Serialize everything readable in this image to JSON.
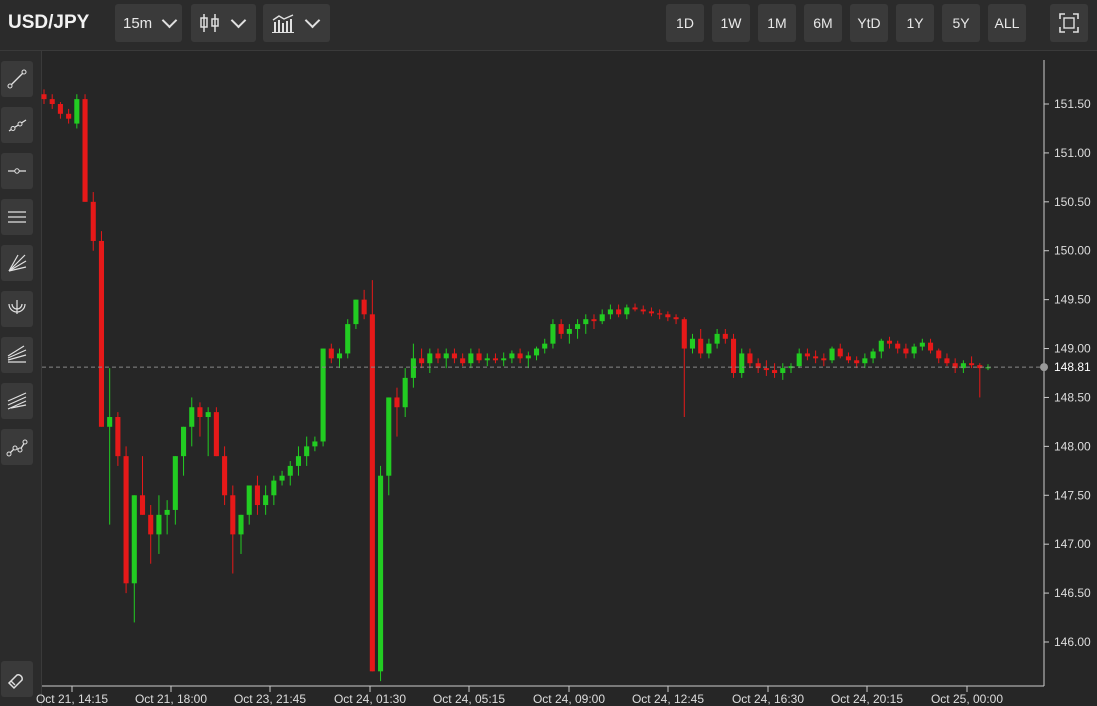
{
  "header": {
    "symbol": "USD/JPY",
    "interval": "15m",
    "chart_style_icon": "candlestick-icon",
    "indicator_icon": "bar-chart-icon",
    "ranges": [
      "1D",
      "1W",
      "1M",
      "6M",
      "YtD",
      "1Y",
      "5Y",
      "ALL"
    ],
    "fullscreen_icon": "fullscreen-icon"
  },
  "toolbar": {
    "tools": [
      "trend-line-icon",
      "ray-icon",
      "horizontal-line-icon",
      "parallel-channel-icon",
      "fan-icon",
      "arc-icon",
      "regression-channel-icon",
      "pitchfork-icon",
      "polyline-icon"
    ],
    "magnet_icon": "magnet-icon"
  },
  "chart_data": {
    "type": "candlestick",
    "symbol": "USD/JPY",
    "interval": "15m",
    "y_ticks": [
      "151.50",
      "151.00",
      "150.50",
      "150.00",
      "149.50",
      "149.00",
      "148.50",
      "148.00",
      "147.50",
      "147.00",
      "146.50",
      "146.00"
    ],
    "x_ticks": [
      "Oct 21, 14:15",
      "Oct 21, 18:00",
      "Oct 23, 21:45",
      "Oct 24, 01:30",
      "Oct 24, 05:15",
      "Oct 24, 09:00",
      "Oct 24, 12:45",
      "Oct 24, 16:30",
      "Oct 24, 20:15",
      "Oct 25, 00:00"
    ],
    "ylim": [
      145.55,
      151.95
    ],
    "last_price": "148.81",
    "last_price_value": 148.81,
    "grid": false,
    "colors": {
      "up": "#22cc22",
      "down": "#e61919",
      "background": "#262626",
      "axis": "#cccccc",
      "crosshair": "#888888"
    },
    "candles": [
      [
        151.6,
        151.65,
        151.5,
        151.55
      ],
      [
        151.55,
        151.6,
        151.45,
        151.5
      ],
      [
        151.5,
        151.52,
        151.35,
        151.4
      ],
      [
        151.4,
        151.45,
        151.3,
        151.35
      ],
      [
        151.3,
        151.6,
        151.25,
        151.55
      ],
      [
        151.55,
        151.6,
        150.5,
        150.5
      ],
      [
        150.5,
        150.6,
        150.0,
        150.1
      ],
      [
        150.1,
        150.2,
        148.2,
        148.2
      ],
      [
        148.2,
        148.8,
        147.2,
        148.3
      ],
      [
        148.3,
        148.35,
        147.8,
        147.9
      ],
      [
        147.9,
        148.0,
        146.5,
        146.6
      ],
      [
        146.6,
        147.5,
        146.2,
        147.5
      ],
      [
        147.5,
        147.9,
        147.3,
        147.3
      ],
      [
        147.3,
        147.4,
        146.8,
        147.1
      ],
      [
        147.1,
        147.5,
        146.9,
        147.3
      ],
      [
        147.3,
        147.45,
        147.1,
        147.35
      ],
      [
        147.35,
        147.9,
        147.2,
        147.9
      ],
      [
        147.9,
        148.2,
        147.7,
        148.2
      ],
      [
        148.2,
        148.5,
        148.0,
        148.4
      ],
      [
        148.4,
        148.45,
        148.1,
        148.3
      ],
      [
        148.3,
        148.4,
        147.9,
        148.35
      ],
      [
        148.35,
        148.4,
        147.9,
        147.9
      ],
      [
        147.9,
        148.0,
        147.4,
        147.5
      ],
      [
        147.5,
        147.6,
        146.7,
        147.1
      ],
      [
        147.1,
        147.3,
        146.9,
        147.3
      ],
      [
        147.3,
        147.6,
        147.2,
        147.6
      ],
      [
        147.6,
        147.7,
        147.3,
        147.4
      ],
      [
        147.4,
        147.6,
        147.3,
        147.5
      ],
      [
        147.5,
        147.7,
        147.4,
        147.65
      ],
      [
        147.65,
        147.75,
        147.6,
        147.7
      ],
      [
        147.7,
        147.85,
        147.6,
        147.8
      ],
      [
        147.8,
        148.0,
        147.7,
        147.9
      ],
      [
        147.9,
        148.1,
        147.8,
        148.0
      ],
      [
        148.0,
        148.1,
        147.95,
        148.05
      ],
      [
        148.05,
        149.0,
        148.0,
        149.0
      ],
      [
        149.0,
        149.05,
        148.85,
        148.9
      ],
      [
        148.9,
        149.0,
        148.8,
        148.95
      ],
      [
        148.95,
        149.3,
        148.9,
        149.25
      ],
      [
        149.25,
        149.5,
        149.2,
        149.5
      ],
      [
        149.5,
        149.6,
        149.3,
        149.35
      ],
      [
        149.35,
        149.7,
        145.7,
        145.7
      ],
      [
        145.7,
        147.8,
        145.6,
        147.7
      ],
      [
        147.7,
        148.5,
        147.5,
        148.5
      ],
      [
        148.5,
        148.6,
        148.1,
        148.4
      ],
      [
        148.4,
        148.8,
        148.3,
        148.7
      ],
      [
        148.7,
        149.05,
        148.6,
        148.9
      ],
      [
        148.9,
        149.0,
        148.8,
        148.85
      ],
      [
        148.85,
        149.0,
        148.75,
        148.95
      ],
      [
        148.95,
        149.0,
        148.85,
        148.9
      ],
      [
        148.9,
        149.0,
        148.8,
        148.95
      ],
      [
        148.95,
        149.0,
        148.85,
        148.9
      ],
      [
        148.9,
        148.95,
        148.82,
        148.85
      ],
      [
        148.85,
        149.0,
        148.8,
        148.95
      ],
      [
        148.95,
        149.0,
        148.85,
        148.88
      ],
      [
        148.88,
        148.95,
        148.82,
        148.9
      ],
      [
        148.9,
        148.95,
        148.85,
        148.88
      ],
      [
        148.88,
        148.96,
        148.82,
        148.9
      ],
      [
        148.9,
        148.98,
        148.85,
        148.95
      ],
      [
        148.95,
        149.0,
        148.85,
        148.9
      ],
      [
        148.9,
        148.97,
        148.8,
        148.93
      ],
      [
        148.93,
        149.02,
        148.88,
        149.0
      ],
      [
        149.0,
        149.1,
        148.95,
        149.05
      ],
      [
        149.05,
        149.3,
        149.0,
        149.25
      ],
      [
        149.25,
        149.3,
        149.1,
        149.15
      ],
      [
        149.15,
        149.25,
        149.05,
        149.2
      ],
      [
        149.2,
        149.3,
        149.1,
        149.25
      ],
      [
        149.25,
        149.35,
        149.15,
        149.3
      ],
      [
        149.3,
        149.35,
        149.2,
        149.28
      ],
      [
        149.28,
        149.4,
        149.25,
        149.35
      ],
      [
        149.35,
        149.45,
        149.3,
        149.4
      ],
      [
        149.4,
        149.45,
        149.32,
        149.35
      ],
      [
        149.35,
        149.45,
        149.3,
        149.42
      ],
      [
        149.42,
        149.46,
        149.38,
        149.4
      ],
      [
        149.4,
        149.44,
        149.35,
        149.38
      ],
      [
        149.38,
        149.42,
        149.33,
        149.36
      ],
      [
        149.36,
        149.4,
        149.3,
        149.35
      ],
      [
        149.35,
        149.38,
        149.28,
        149.32
      ],
      [
        149.32,
        149.35,
        149.25,
        149.3
      ],
      [
        149.3,
        149.32,
        148.3,
        149.0
      ],
      [
        149.0,
        149.15,
        148.95,
        149.1
      ],
      [
        149.1,
        149.2,
        148.9,
        148.95
      ],
      [
        148.95,
        149.1,
        148.9,
        149.05
      ],
      [
        149.05,
        149.2,
        149.0,
        149.15
      ],
      [
        149.15,
        149.2,
        149.05,
        149.1
      ],
      [
        149.1,
        149.15,
        148.7,
        148.75
      ],
      [
        148.75,
        149.0,
        148.7,
        148.95
      ],
      [
        148.95,
        149.0,
        148.8,
        148.85
      ],
      [
        148.85,
        148.9,
        148.75,
        148.8
      ],
      [
        148.8,
        148.88,
        148.72,
        148.78
      ],
      [
        148.78,
        148.85,
        148.7,
        148.75
      ],
      [
        148.75,
        148.85,
        148.68,
        148.8
      ],
      [
        148.8,
        148.85,
        148.75,
        148.82
      ],
      [
        148.82,
        149.0,
        148.8,
        148.95
      ],
      [
        148.95,
        149.0,
        148.88,
        148.92
      ],
      [
        148.92,
        148.98,
        148.85,
        148.9
      ],
      [
        148.9,
        148.95,
        148.82,
        148.88
      ],
      [
        148.88,
        149.02,
        148.85,
        149.0
      ],
      [
        149.0,
        149.05,
        148.9,
        148.92
      ],
      [
        148.92,
        148.96,
        148.85,
        148.88
      ],
      [
        148.88,
        148.92,
        148.8,
        148.85
      ],
      [
        148.85,
        148.95,
        148.8,
        148.9
      ],
      [
        148.9,
        149.0,
        148.85,
        148.97
      ],
      [
        148.97,
        149.1,
        148.9,
        149.08
      ],
      [
        149.08,
        149.12,
        149.0,
        149.05
      ],
      [
        149.05,
        149.08,
        148.95,
        149.0
      ],
      [
        149.0,
        149.05,
        148.9,
        148.95
      ],
      [
        148.95,
        149.05,
        148.9,
        149.02
      ],
      [
        149.02,
        149.1,
        148.98,
        149.06
      ],
      [
        149.06,
        149.1,
        148.95,
        148.98
      ],
      [
        148.98,
        149.0,
        148.85,
        148.9
      ],
      [
        148.9,
        148.95,
        148.82,
        148.85
      ],
      [
        148.85,
        148.9,
        148.75,
        148.8
      ],
      [
        148.8,
        148.88,
        148.75,
        148.85
      ],
      [
        148.85,
        148.92,
        148.8,
        148.83
      ],
      [
        148.83,
        148.85,
        148.5,
        148.8
      ],
      [
        148.8,
        148.84,
        148.78,
        148.81
      ]
    ]
  }
}
